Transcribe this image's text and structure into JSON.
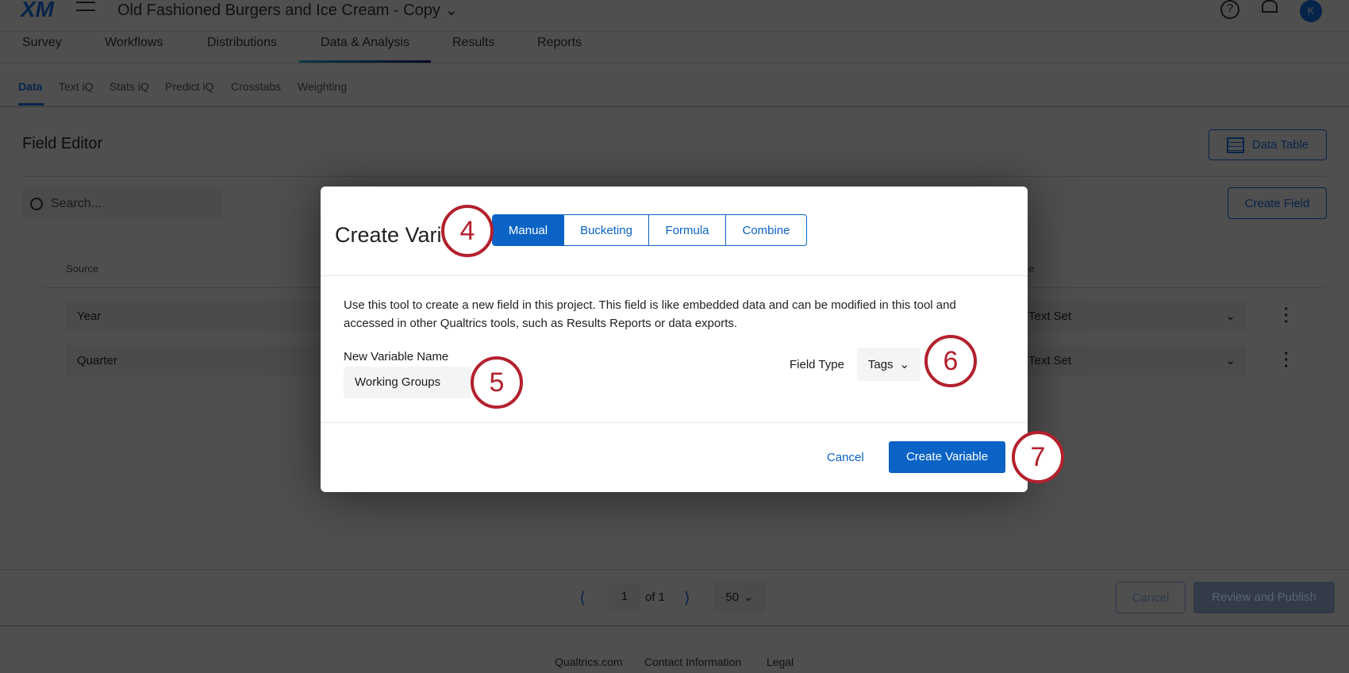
{
  "header": {
    "logo": "XM",
    "survey_title": "Old Fashioned Burgers and Ice Cream - Copy",
    "avatar_initial": "K"
  },
  "tabs": [
    "Survey",
    "Workflows",
    "Distributions",
    "Data & Analysis",
    "Results",
    "Reports"
  ],
  "subtabs": [
    "Data",
    "Text iQ",
    "Stats iQ",
    "Predict iQ",
    "Crosstabs",
    "Weighting"
  ],
  "page": {
    "title": "Field Editor",
    "data_table_label": "Data Table",
    "create_field_label": "Create Field",
    "search_placeholder": "Search...",
    "col_source": "Source",
    "col_type_partial": "e",
    "rows": [
      {
        "name": "Year",
        "type": "Text Set"
      },
      {
        "name": "Quarter",
        "type": "Text Set"
      }
    ]
  },
  "pagination": {
    "page": "1",
    "of": "of 1",
    "per_page": "50"
  },
  "actions": {
    "cancel": "Cancel",
    "publish": "Review and Publish"
  },
  "footer": [
    "Qualtrics.com",
    "Contact Information",
    "Legal"
  ],
  "modal": {
    "title": "Create Vari",
    "modes": [
      "Manual",
      "Bucketing",
      "Formula",
      "Combine"
    ],
    "description": "Use this tool to create a new field in this project. This field is like embedded data and can be modified in this tool and accessed in other Qualtrics tools, such as Results Reports or data exports.",
    "name_label": "New Variable Name",
    "name_value": "Working Groups",
    "field_type_label": "Field Type",
    "field_type_value": "Tags",
    "cancel": "Cancel",
    "create": "Create Variable"
  },
  "steps": [
    "4",
    "5",
    "6",
    "7"
  ]
}
